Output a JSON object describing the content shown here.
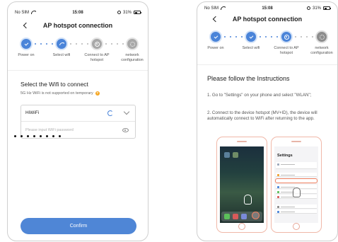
{
  "status_bar": {
    "carrier": "No SIM",
    "time": "15:08",
    "battery": "31%"
  },
  "left_screen": {
    "nav": {
      "title": "AP hotspot connection"
    },
    "steps": [
      {
        "label": "Power on",
        "state": "done",
        "icon": "check-icon"
      },
      {
        "label": "Select wifi",
        "state": "active",
        "icon": "wifi-icon"
      },
      {
        "label": "Connect to AP hotspot",
        "state": "pending",
        "icon": "signal-icon"
      },
      {
        "label": "network configuration",
        "state": "pending",
        "icon": "gear-icon"
      }
    ],
    "section_title": "Select the Wifi to connect",
    "notice": "5G Hz WiFi is not supported on temporary",
    "wifi_ssid": "HiWiFi",
    "password_placeholder": "Please input WiFi password",
    "confirm_label": "Confirm"
  },
  "right_screen": {
    "nav": {
      "title": "AP hotspot connection"
    },
    "steps": [
      {
        "label": "Power on",
        "state": "done",
        "icon": "check-icon"
      },
      {
        "label": "Select wifi",
        "state": "done",
        "icon": "check-icon"
      },
      {
        "label": "Connect to AP hotspot",
        "state": "active",
        "icon": "signal-icon"
      },
      {
        "label": "network configuration",
        "state": "pending",
        "icon": "gear-icon"
      }
    ],
    "instructions_title": "Please follow the Instructions",
    "instruction_1": "1. Go to \"Settings\" on your phone and select \"WLAN\";",
    "instruction_2": "2. Connect to the device hotspot (MV+ID), the device will automatically connect to WiFi after returning to the app.",
    "demo_settings_title": "Settings"
  },
  "colors": {
    "accent": "#4a84d9",
    "button": "#4f86d6",
    "highlight": "#f08060"
  }
}
